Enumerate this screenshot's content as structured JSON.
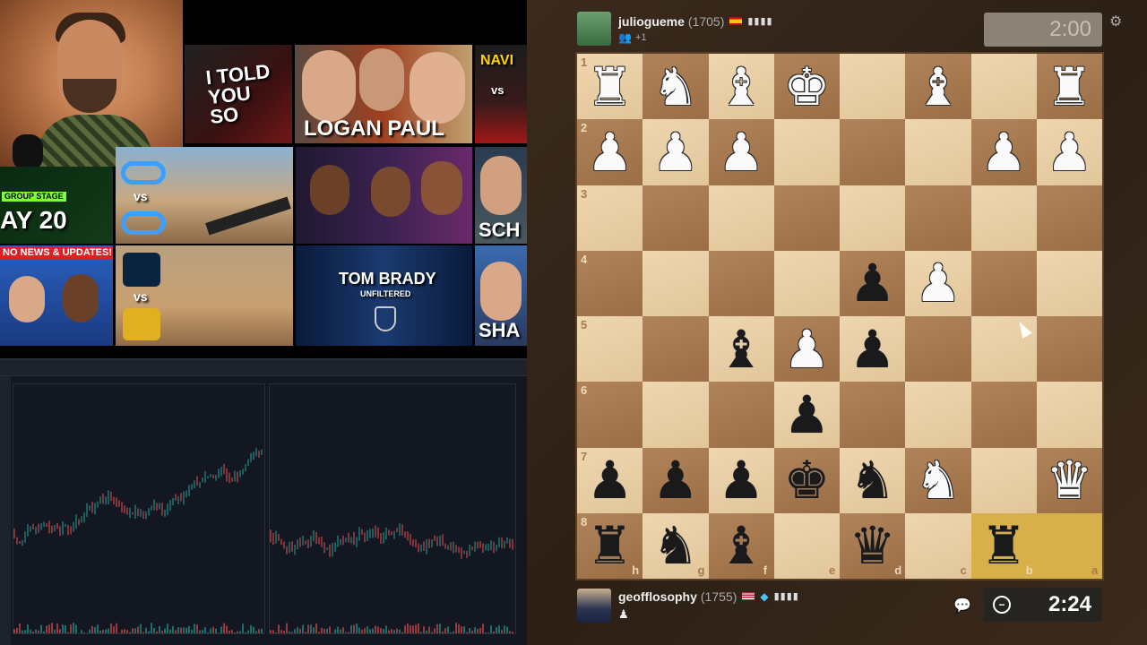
{
  "stream": {
    "thumbnails": [
      {
        "id": "told",
        "text": "I TOLD YOU SO"
      },
      {
        "id": "logan",
        "text": "LOGAN PAUL"
      },
      {
        "id": "navi",
        "text": "NAVI",
        "sub": "vs"
      },
      {
        "id": "day20",
        "text": "AY 20",
        "sub": "GROUP STAGE"
      },
      {
        "id": "csgo1",
        "sub": "vs"
      },
      {
        "id": "news",
        "text": "NO NEWS & UPDATES!"
      },
      {
        "id": "liquid",
        "sub": "vs"
      },
      {
        "id": "brady",
        "text": "TOM BRADY",
        "sub": "UNFILTERED"
      },
      {
        "id": "sch",
        "text": "SCH"
      },
      {
        "id": "sha",
        "text": "SHA"
      }
    ]
  },
  "top_player": {
    "name": "juliogueme",
    "rating": "(1705)",
    "flag": "ES",
    "extra": "+1",
    "clock": "2:00"
  },
  "bottom_player": {
    "name": "geofflosophy",
    "rating": "(1755)",
    "flag": "US",
    "clock": "2:24"
  },
  "board": {
    "orientation": "black",
    "rank_labels": [
      "1",
      "2",
      "3",
      "4",
      "5",
      "6",
      "7",
      "8"
    ],
    "file_labels": [
      "h",
      "g",
      "f",
      "e",
      "d",
      "c",
      "b",
      "a"
    ],
    "highlight": [
      [
        7,
        7
      ],
      [
        7,
        6
      ]
    ],
    "pieces": [
      {
        "glyph": "♜",
        "color": "white",
        "row": 0,
        "col": 0
      },
      {
        "glyph": "♞",
        "color": "white",
        "row": 0,
        "col": 1
      },
      {
        "glyph": "♝",
        "color": "white",
        "row": 0,
        "col": 2
      },
      {
        "glyph": "♚",
        "color": "white",
        "row": 0,
        "col": 3
      },
      {
        "glyph": "♝",
        "color": "white",
        "row": 0,
        "col": 5
      },
      {
        "glyph": "♜",
        "color": "white",
        "row": 0,
        "col": 7
      },
      {
        "glyph": "♟",
        "color": "white",
        "row": 1,
        "col": 0
      },
      {
        "glyph": "♟",
        "color": "white",
        "row": 1,
        "col": 1
      },
      {
        "glyph": "♟",
        "color": "white",
        "row": 1,
        "col": 2
      },
      {
        "glyph": "♟",
        "color": "white",
        "row": 1,
        "col": 6
      },
      {
        "glyph": "♟",
        "color": "white",
        "row": 1,
        "col": 7
      },
      {
        "glyph": "♟",
        "color": "black",
        "row": 3,
        "col": 4
      },
      {
        "glyph": "♟",
        "color": "white",
        "row": 3,
        "col": 5
      },
      {
        "glyph": "♝",
        "color": "black",
        "row": 4,
        "col": 2
      },
      {
        "glyph": "♟",
        "color": "white",
        "row": 4,
        "col": 3
      },
      {
        "glyph": "♟",
        "color": "black",
        "row": 4,
        "col": 4
      },
      {
        "glyph": "♟",
        "color": "black",
        "row": 5,
        "col": 3
      },
      {
        "glyph": "♟",
        "color": "black",
        "row": 6,
        "col": 0
      },
      {
        "glyph": "♟",
        "color": "black",
        "row": 6,
        "col": 1
      },
      {
        "glyph": "♟",
        "color": "black",
        "row": 6,
        "col": 2
      },
      {
        "glyph": "♚",
        "color": "black",
        "row": 6,
        "col": 3
      },
      {
        "glyph": "♞",
        "color": "black",
        "row": 6,
        "col": 4
      },
      {
        "glyph": "♞",
        "color": "white",
        "row": 6,
        "col": 5
      },
      {
        "glyph": "♛",
        "color": "white",
        "row": 6,
        "col": 7
      },
      {
        "glyph": "♜",
        "color": "black",
        "row": 7,
        "col": 0
      },
      {
        "glyph": "♞",
        "color": "black",
        "row": 7,
        "col": 1
      },
      {
        "glyph": "♝",
        "color": "black",
        "row": 7,
        "col": 2
      },
      {
        "glyph": "♛",
        "color": "black",
        "row": 7,
        "col": 4
      },
      {
        "glyph": "♜",
        "color": "black",
        "row": 7,
        "col": 6
      }
    ]
  }
}
